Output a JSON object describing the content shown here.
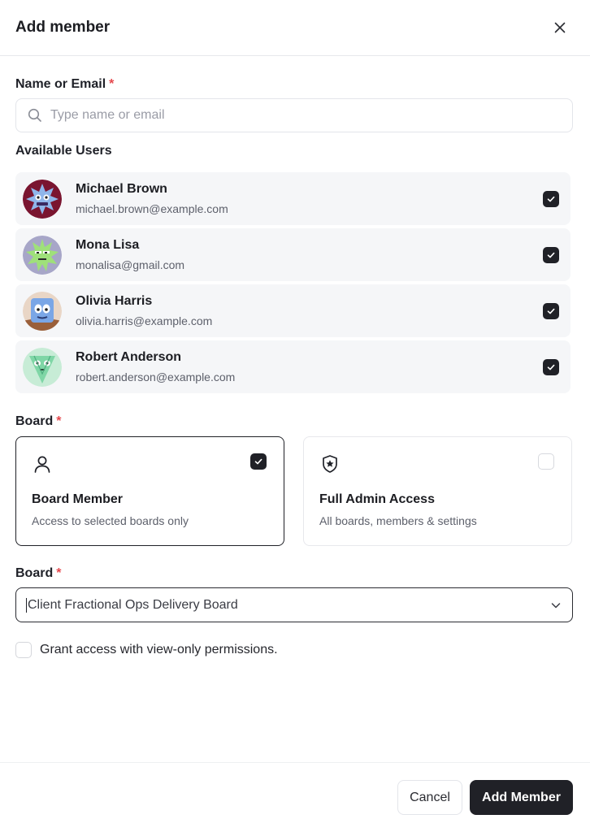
{
  "dialog": {
    "title": "Add member"
  },
  "search": {
    "label": "Name or Email",
    "required_mark": "*",
    "placeholder": "Type name or email",
    "value": ""
  },
  "available_users": {
    "label": "Available Users",
    "items": [
      {
        "name": "Michael Brown",
        "email": "michael.brown@example.com",
        "checked": true,
        "avatar_icon": "monster-avatar-red"
      },
      {
        "name": "Mona Lisa",
        "email": "monalisa@gmail.com",
        "checked": true,
        "avatar_icon": "monster-avatar-green"
      },
      {
        "name": "Olivia Harris",
        "email": "olivia.harris@example.com",
        "checked": true,
        "avatar_icon": "monster-avatar-blue"
      },
      {
        "name": "Robert Anderson",
        "email": "robert.anderson@example.com",
        "checked": true,
        "avatar_icon": "monster-avatar-mint"
      }
    ]
  },
  "role": {
    "label": "Board",
    "required_mark": "*",
    "options": [
      {
        "title": "Board Member",
        "description": "Access to selected boards only",
        "icon": "user-icon",
        "selected": true
      },
      {
        "title": "Full Admin Access",
        "description": "All boards, members & settings",
        "icon": "shield-star-icon",
        "selected": false
      }
    ]
  },
  "board_select": {
    "label": "Board",
    "required_mark": "*",
    "value": "Client Fractional Ops Delivery Board"
  },
  "view_only": {
    "label": "Grant access with view-only permissions.",
    "checked": false
  },
  "footer": {
    "cancel_label": "Cancel",
    "submit_label": "Add Member"
  },
  "colors": {
    "primary": "#202127",
    "required": "#e5484d",
    "row_bg": "#f5f6f8"
  }
}
